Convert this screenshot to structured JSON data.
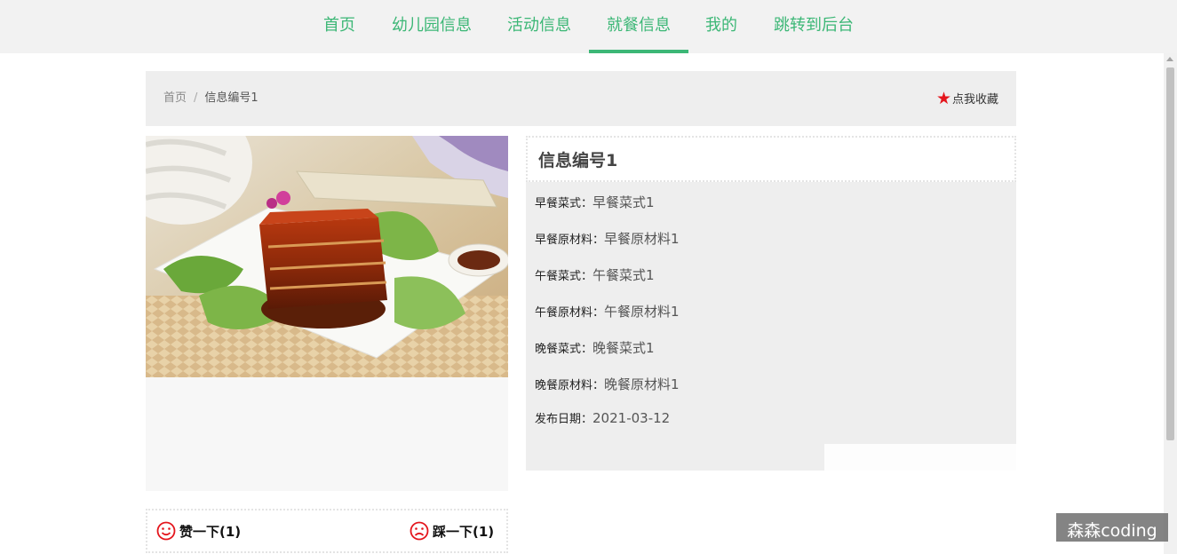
{
  "nav": {
    "items": [
      {
        "label": "首页"
      },
      {
        "label": "幼儿园信息"
      },
      {
        "label": "活动信息"
      },
      {
        "label": "就餐信息",
        "active": true
      },
      {
        "label": "我的"
      },
      {
        "label": "跳转到后台"
      }
    ]
  },
  "breadcrumb": {
    "home": "首页",
    "separator": "/",
    "current": "信息编号1"
  },
  "favorite": {
    "label": "点我收藏",
    "icon": "star-icon"
  },
  "detail": {
    "title": "信息编号1",
    "fields": [
      {
        "label": "早餐菜式：",
        "value": "早餐菜式1"
      },
      {
        "label": "早餐原材料：",
        "value": "早餐原材料1"
      },
      {
        "label": "午餐菜式：",
        "value": "午餐菜式1"
      },
      {
        "label": "午餐原材料：",
        "value": "午餐原材料1"
      },
      {
        "label": "晚餐菜式：",
        "value": "晚餐菜式1"
      },
      {
        "label": "晚餐原材料：",
        "value": "晚餐原材料1"
      },
      {
        "label": "发布日期：",
        "value": "2021-03-12"
      }
    ]
  },
  "votes": {
    "like": {
      "label": "赞一下(1)",
      "icon": "smile-icon"
    },
    "dislike": {
      "label": "踩一下(1)",
      "icon": "frown-icon"
    }
  },
  "watermark": "森森coding",
  "colors": {
    "accent": "#3cb776",
    "star": "#e4161d"
  }
}
